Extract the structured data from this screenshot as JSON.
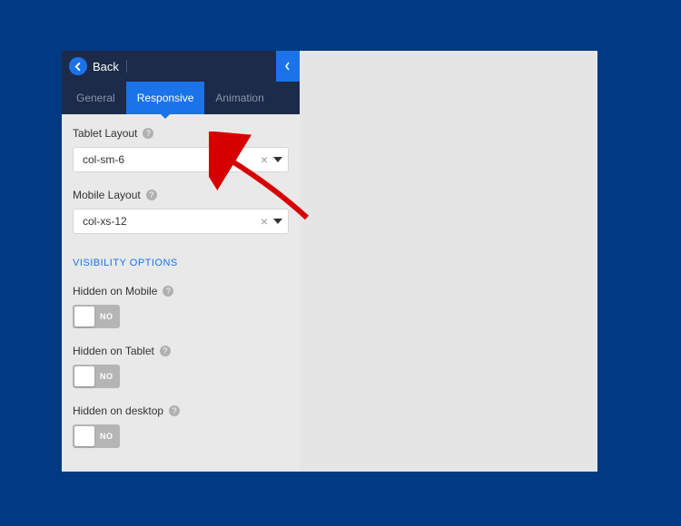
{
  "header": {
    "back_label": "Back"
  },
  "tabs": {
    "general": "General",
    "responsive": "Responsive",
    "animation": "Animation"
  },
  "fields": {
    "tablet_layout": {
      "label": "Tablet Layout",
      "value": "col-sm-6"
    },
    "mobile_layout": {
      "label": "Mobile Layout",
      "value": "col-xs-12"
    }
  },
  "visibility": {
    "section_title": "VISIBILITY OPTIONS",
    "hidden_mobile": {
      "label": "Hidden on Mobile",
      "state": "NO"
    },
    "hidden_tablet": {
      "label": "Hidden on Tablet",
      "state": "NO"
    },
    "hidden_desktop": {
      "label": "Hidden on desktop",
      "state": "NO"
    }
  }
}
